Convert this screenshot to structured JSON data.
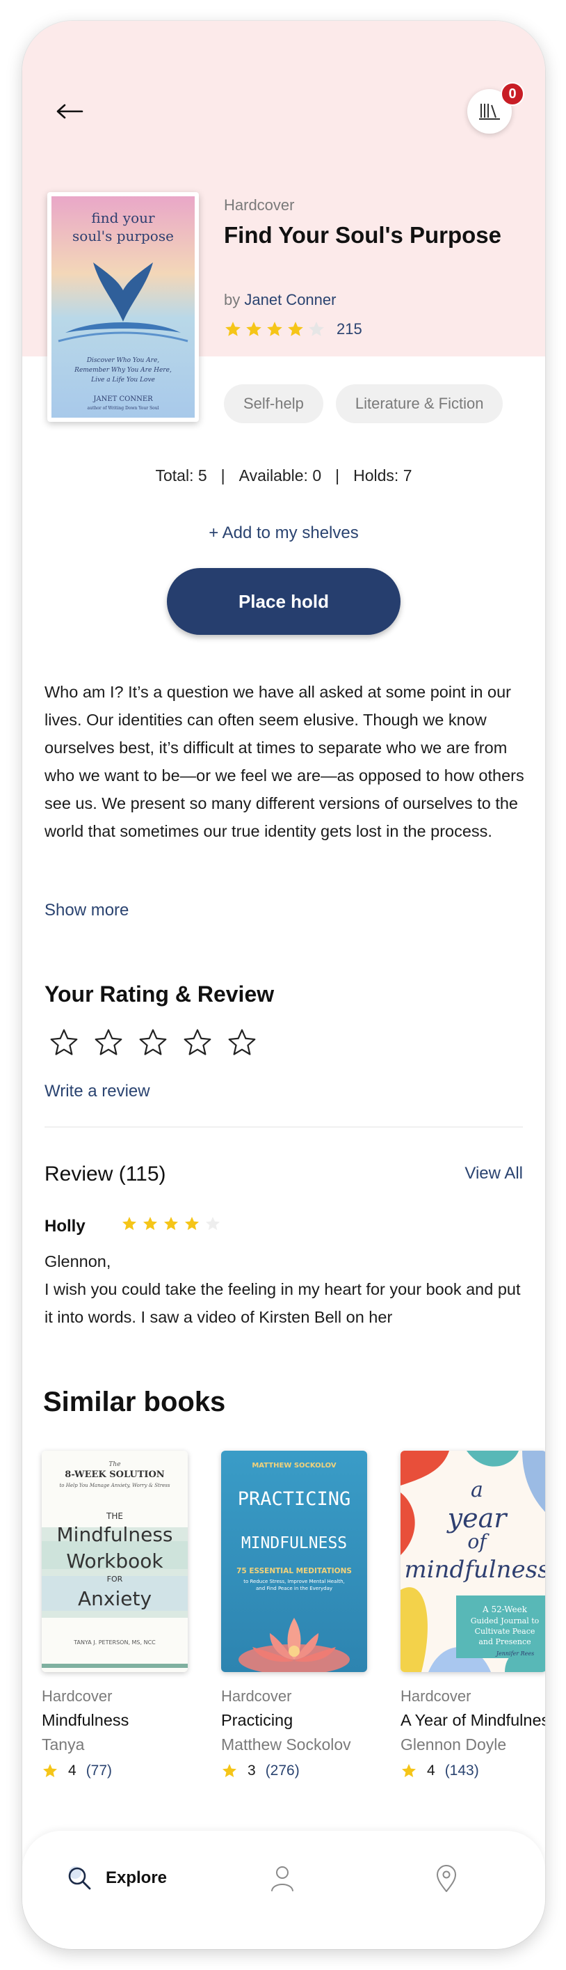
{
  "header": {
    "back_icon": "arrow-left-icon",
    "shelf_icon": "bookshelf-icon",
    "shelf_count": "0"
  },
  "book": {
    "cover_title": "find your soul's purpose",
    "cover_subtitle": "Discover Who You Are, Remember Why You Are Here, Live a Life You Love",
    "cover_author": "JANET CONNER",
    "cover_tagline": "author of Writing Down Your Soul",
    "format": "Hardcover",
    "title": "Find Your Soul's Purpose",
    "author_prefix": "by",
    "author": "Janet Conner",
    "rating": 4,
    "rating_count": "215"
  },
  "genres": [
    "Self-help",
    "Literature & Fiction"
  ],
  "availability": {
    "total": "Total: 5",
    "available": "Available: 0",
    "holds": "Holds: 7",
    "separator": "|"
  },
  "actions": {
    "add_to_shelves": "+ Add to my shelves",
    "place_hold": "Place hold"
  },
  "description": {
    "text": "Who am I? It’s a question we have all asked at some point in our lives. Our identities can often seem elusive. Though we know ourselves best, it’s difficult at times to separate who we are from who we want to be—or we feel we are—as opposed to how others see us. We present so many different versions of ourselves to the world that sometimes our true identity gets lost in the process.",
    "show_more": "Show more"
  },
  "your_rating": {
    "title": "Your Rating & Review",
    "write_review": "Write a review"
  },
  "reviews": {
    "title": "Review (115)",
    "view_all": "View All",
    "items": [
      {
        "reviewer": "Holly",
        "rating": 4,
        "text": "Glennon,\nI wish you could take the feeling in my heart for your book and put it into words. I saw a video of Kirsten Bell on her"
      }
    ]
  },
  "similar": {
    "title": "Similar books",
    "books": [
      {
        "format": "Hardcover",
        "title": "Mindfulness",
        "author": "Tanya",
        "rating": "4",
        "count": "(77)",
        "cover_lines": [
          "The",
          "8-WEEK SOLUTION",
          "to Help You Manage Anxiety, Worry & Stress",
          "THE",
          "Mindfulness",
          "Workbook",
          "FOR",
          "Anxiety",
          "TANYA J. PETERSON, MS, NCC"
        ]
      },
      {
        "format": "Hardcover",
        "title": "Practicing",
        "author": "Matthew Sockolov",
        "rating": "3",
        "count": "(276)",
        "cover_lines": [
          "MATTHEW SOCKOLOV",
          "PRACTICING",
          "MINDFULNESS",
          "75 ESSENTIAL MEDITATIONS",
          "to Reduce Stress, Improve Mental Health,",
          "and Find Peace in the Everyday"
        ]
      },
      {
        "format": "Hardcover",
        "title": "A Year of Mindfulness",
        "author": "Glennon Doyle",
        "rating": "4",
        "count": "(143)",
        "cover_lines": [
          "a",
          "year",
          "of",
          "mindfulness",
          "A 52-Week",
          "Guided Journal to",
          "Cultivate Peace",
          "and Presence",
          "Jennifer Rees"
        ]
      }
    ]
  },
  "nav": {
    "explore": "Explore",
    "explore_icon": "search-icon",
    "profile_icon": "user-icon",
    "location_icon": "location-pin-icon"
  },
  "colors": {
    "accent": "#263e6e",
    "link": "#2a4370",
    "star": "#f5c518",
    "hero_bg": "#fceaea",
    "badge": "#c81d25"
  }
}
